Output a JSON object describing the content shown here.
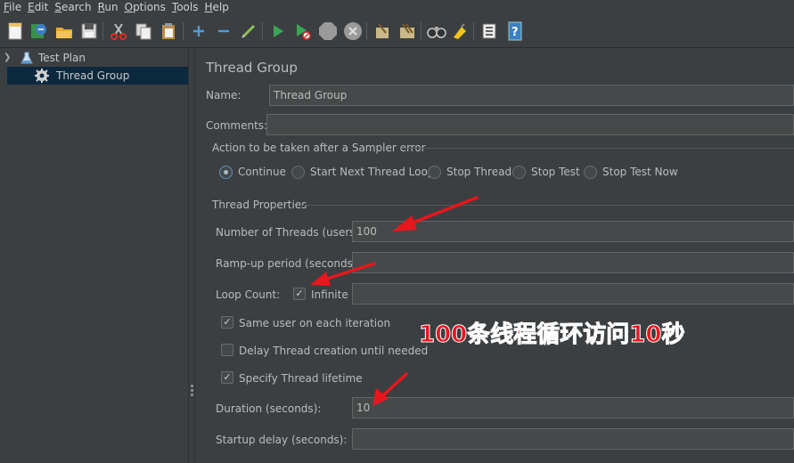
{
  "menu": [
    {
      "u": "F",
      "rest": "ile"
    },
    {
      "u": "E",
      "rest": "dit"
    },
    {
      "u": "S",
      "rest": "earch"
    },
    {
      "u": "R",
      "rest": "un"
    },
    {
      "u": "O",
      "rest": "ptions"
    },
    {
      "u": "T",
      "rest": "ools"
    },
    {
      "u": "H",
      "rest": "elp"
    }
  ],
  "tree": {
    "test_plan": "Test Plan",
    "thread_group": "Thread Group"
  },
  "panel": {
    "title": "Thread Group",
    "name_label": "Name:",
    "name_value": "Thread Group",
    "comments_label": "Comments:",
    "comments_value": "",
    "error_group_label": "Action to be taken after a Sampler error",
    "error_actions": [
      "Continue",
      "Start Next Thread Loop",
      "Stop Thread",
      "Stop Test",
      "Stop Test Now"
    ],
    "selected_error_action": "Continue",
    "thread_props_label": "Thread Properties",
    "threads_label": "Number of Threads (users):",
    "threads_value": "100",
    "rampup_label": "Ramp-up period (seconds):",
    "rampup_value": "",
    "loop_label": "Loop Count:",
    "infinite_label": "Infinite",
    "infinite_checked": true,
    "loop_value": "",
    "same_user_label": "Same user on each iteration",
    "same_user_checked": true,
    "delay_label": "Delay Thread creation until needed",
    "delay_checked": false,
    "lifetime_label": "Specify Thread lifetime",
    "lifetime_checked": true,
    "duration_label": "Duration (seconds):",
    "duration_value": "10",
    "startup_label": "Startup delay (seconds):",
    "startup_value": ""
  },
  "annotation": "100条线程循环访问10秒",
  "colors": {
    "background": "#3c3f41",
    "selection": "#0d293e",
    "annotation_red": "#e8161d"
  }
}
